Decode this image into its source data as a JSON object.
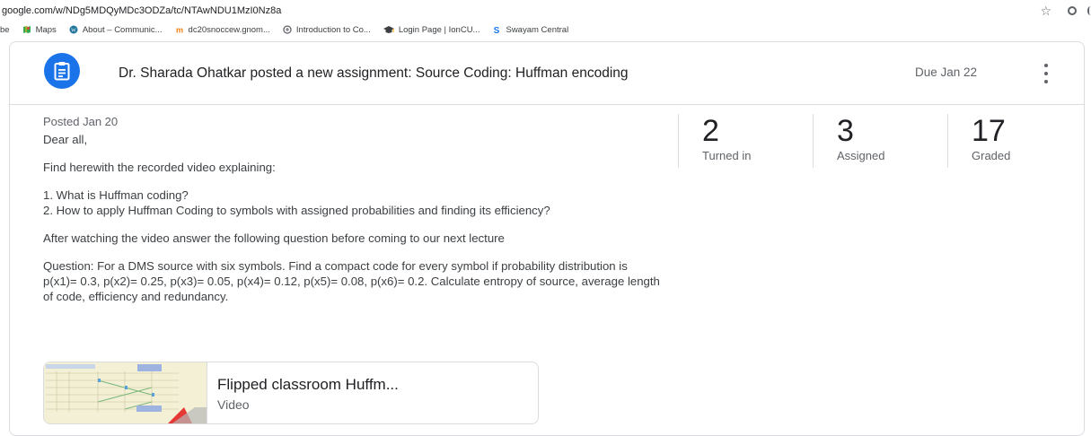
{
  "browser": {
    "url": "google.com/w/NDg5MDQyMDc3ODZa/tc/NTAwNDU1MzI0Nz8a",
    "bookmarks": [
      {
        "label": "be",
        "icon": "",
        "color": ""
      },
      {
        "label": "Maps",
        "icon": "maps-icon",
        "color": "#34a853"
      },
      {
        "label": "About – Communic...",
        "icon": "wordpress-icon",
        "color": "#21759b"
      },
      {
        "label": "dc20snoccew.gnom...",
        "icon": "moodle-icon",
        "color": "#f98012"
      },
      {
        "label": "Introduction to Co...",
        "icon": "globe-icon",
        "color": "#5f6368"
      },
      {
        "label": "Login Page | IonCU...",
        "icon": "graduation-icon",
        "color": "#3c4043"
      },
      {
        "label": "Swayam Central",
        "icon": "swayam-icon",
        "color": "#1a73e8"
      }
    ]
  },
  "header": {
    "title": "Dr. Sharada Ohatkar posted a new assignment: Source Coding: Huffman encoding",
    "due": "Due Jan 22",
    "icon": "assignment-icon",
    "accent": "#1a73e8"
  },
  "post": {
    "posted": "Posted Jan 20",
    "paragraphs": [
      "Dear all,",
      "Find herewith the recorded video explaining:",
      "1. What is Huffman coding?\n2. How to apply Huffman Coding to symbols with assigned probabilities and finding its efficiency?",
      "After watching the video answer the following question before coming to our next lecture",
      "Question:  For a DMS source with six symbols. Find a compact code for every symbol if probability distribution is p(x1)= 0.3, p(x2)= 0.25, p(x3)= 0.05, p(x4)= 0.12, p(x5)= 0.08, p(x6)= 0.2. Calculate entropy of source, average length of code, efficiency and redundancy."
    ]
  },
  "stats": [
    {
      "num": "2",
      "label": "Turned in"
    },
    {
      "num": "3",
      "label": "Assigned"
    },
    {
      "num": "17",
      "label": "Graded"
    }
  ],
  "attachment": {
    "title": "Flipped classroom Huffm...",
    "type": "Video"
  }
}
